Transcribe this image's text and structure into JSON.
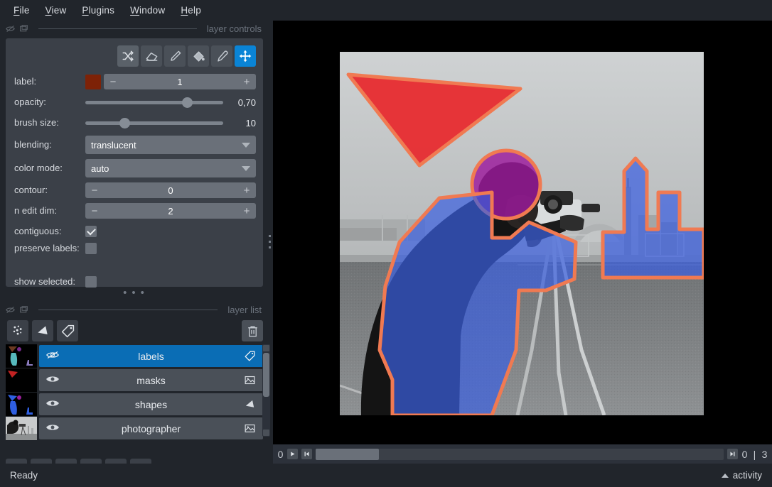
{
  "menu": {
    "items": [
      {
        "label": "File",
        "mnemonic": "F"
      },
      {
        "label": "View",
        "mnemonic": "V"
      },
      {
        "label": "Plugins",
        "mnemonic": "P"
      },
      {
        "label": "Window",
        "mnemonic": "W"
      },
      {
        "label": "Help",
        "mnemonic": "H"
      }
    ]
  },
  "layer_controls": {
    "dock_title": "layer controls",
    "tools": [
      {
        "name": "shuffle-colors-tool",
        "active": false
      },
      {
        "name": "eraser-tool",
        "active": false
      },
      {
        "name": "paint-brush-tool",
        "active": false
      },
      {
        "name": "fill-bucket-tool",
        "active": false
      },
      {
        "name": "color-picker-tool",
        "active": false
      },
      {
        "name": "pan-zoom-tool",
        "active": true
      }
    ],
    "label": {
      "caption": "label:",
      "value": "1",
      "color": "#7d2207",
      "minus": "−",
      "plus": "+"
    },
    "opacity": {
      "caption": "opacity:",
      "value": "0,70",
      "fraction": 0.7
    },
    "brush_size": {
      "caption": "brush size:",
      "value": "10",
      "fraction": 0.245
    },
    "blending": {
      "caption": "blending:",
      "value": "translucent"
    },
    "color_mode": {
      "caption": "color mode:",
      "value": "auto"
    },
    "contour": {
      "caption": "contour:",
      "value": "0",
      "minus": "−",
      "plus": "+"
    },
    "n_edit_dim": {
      "caption": "n edit dim:",
      "value": "2",
      "minus": "−",
      "plus": "+"
    },
    "contiguous": {
      "caption": "contiguous:",
      "checked": true
    },
    "preserve_labels": {
      "caption": "preserve labels:",
      "checked": false
    },
    "show_selected": {
      "caption": "show selected:",
      "checked": false
    },
    "handle_dots": "• • •"
  },
  "layer_list": {
    "dock_title": "layer list",
    "buttons": [
      {
        "name": "new-points-layer-button"
      },
      {
        "name": "new-shapes-layer-button"
      },
      {
        "name": "new-labels-layer-button"
      },
      {
        "name": "delete-layer-button"
      }
    ],
    "layers": [
      {
        "name": "labels",
        "selected": true,
        "visible": false,
        "type": "labels"
      },
      {
        "name": "masks",
        "selected": false,
        "visible": true,
        "type": "image"
      },
      {
        "name": "shapes",
        "selected": false,
        "visible": true,
        "type": "shapes"
      },
      {
        "name": "photographer",
        "selected": false,
        "visible": true,
        "type": "image"
      }
    ]
  },
  "viewer_buttons": [
    {
      "name": "console-button"
    },
    {
      "name": "ndisplay-toggle-button"
    },
    {
      "name": "roll-dims-button"
    },
    {
      "name": "transpose-dims-button"
    },
    {
      "name": "grid-view-button"
    },
    {
      "name": "reset-view-home-button"
    }
  ],
  "dims_slider": {
    "axis_label": "0",
    "play_glyph": "▶",
    "first_glyph": "▐◀",
    "last_glyph": "▶▌",
    "current": "0",
    "separator": "|",
    "max": "3",
    "handle_fraction": 0.155
  },
  "canvas": {
    "shapes": [
      {
        "name": "triangle-shape",
        "fill": "#e8272b",
        "stroke": "#f07a52"
      },
      {
        "name": "circle-shape",
        "fill": "#9c1a9c",
        "stroke": "#f07a52"
      },
      {
        "name": "polygon-shape",
        "fill": "#3b5fe0",
        "stroke": "#f07a52"
      },
      {
        "name": "building-shape",
        "fill": "#3b5fe0",
        "stroke": "#f07a52"
      }
    ]
  },
  "statusbar": {
    "status": "Ready",
    "activity": "activity"
  }
}
